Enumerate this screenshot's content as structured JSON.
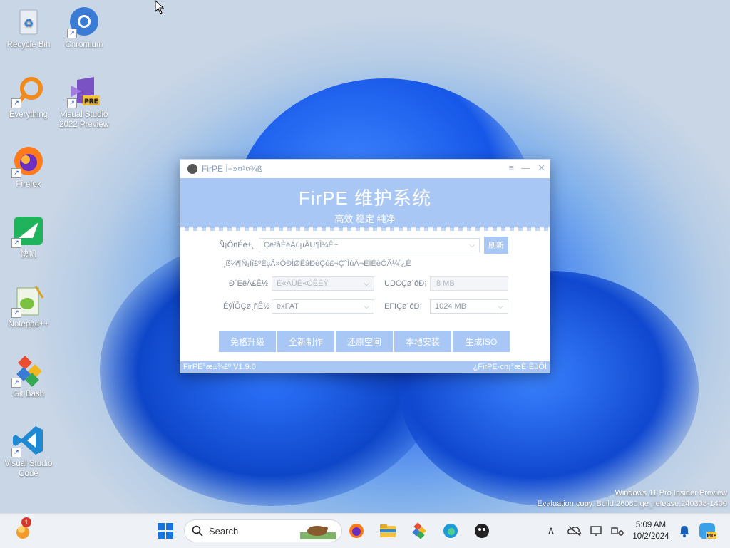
{
  "desktop": {
    "icons": [
      {
        "label": "Recycle Bin"
      },
      {
        "label": "Chromium"
      },
      {
        "label": "Everything"
      },
      {
        "label": "Visual Studio 2022 Preview"
      },
      {
        "label": "Firefox"
      },
      {
        "label": "快帆"
      },
      {
        "label": "Notepad++"
      },
      {
        "label": "Git Bash"
      },
      {
        "label": "Visual Studio Code"
      }
    ]
  },
  "window": {
    "title": "FirPE Î¬»¤¹¤¾ß",
    "banner_title": "FirPE 维护系统",
    "banner_subtitle": "高效 稳定 纯净",
    "device_label": "Ñ¡ÔñÉè±¸",
    "device_value": "Çë²åÈëÄúµÄU¶Ì¼Ê~",
    "refresh_label": "刷新",
    "hint": "¸ß¼¶Ñ¡Ïî£ºÈçÃ»ÓÐÌØÊâÐèÇó£¬Ç°ÍùÄ¬ÈÏÉèÖÃ¼´¿É",
    "install_mode_label": "Ð´ÈëÄ£Ê½",
    "install_mode_value": "È«ÄÜÈ«ÔÊÈÝ",
    "udc_label": "UDCÇø´óÐ¡",
    "udc_value": "8 MB",
    "fs_label": "ÉýÏÕÇø¸ñÊ½",
    "fs_value": "exFAT",
    "efi_label": "EFIÇø´óÐ¡",
    "efi_value": "1024 MB",
    "actions": [
      "免格升级",
      "全新制作",
      "还原空间",
      "本地安装",
      "生成ISO"
    ],
    "footer_version": "FirPE°æ±¾£º V1.9.0",
    "footer_link": "¿FirPE·cn¡°æÈ·ÈùÔÌ"
  },
  "watermark": {
    "line1": "Windows 11 Pro Insider Preview",
    "line2": "Evaluation copy. Build 26080.ge_release.240308-1400"
  },
  "taskbar": {
    "search_placeholder": "Search",
    "notification_count": "1",
    "time": "5:09 AM",
    "date": "10/2/2024"
  }
}
